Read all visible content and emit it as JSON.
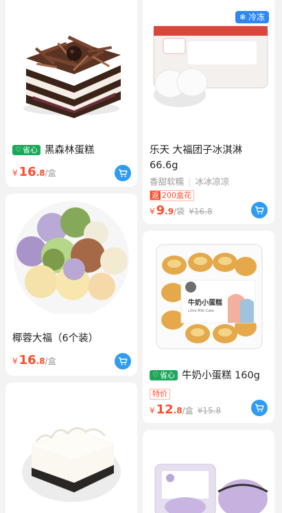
{
  "products": [
    {
      "title": "黑森林蛋糕",
      "badge": "省心",
      "price_currency": "¥",
      "price_int": "16",
      "price_dec": ".8",
      "price_unit": "/盒"
    },
    {
      "title": "乐天 大福团子冰淇淋66.6g",
      "tag1": "香甜软糯",
      "tag2": "冰冰凉凉",
      "promo_prefix": "返",
      "promo_text": "200盒花",
      "price_currency": "¥",
      "price_int": "9",
      "price_dec": ".9",
      "price_unit": "/袋",
      "price_orig": "¥16.8",
      "frozen_label": "冷冻"
    },
    {
      "title": "椰蓉大福（6个装）",
      "price_currency": "¥",
      "price_int": "16",
      "price_dec": ".8",
      "price_unit": "/盒"
    },
    {
      "title": "牛奶小蛋糕 160g",
      "badge": "省心",
      "promo_text": "特价",
      "price_currency": "¥",
      "price_int": "12",
      "price_dec": ".8",
      "price_unit": "/盒",
      "price_orig": "¥15.8",
      "box_label": "牛奶小蛋糕",
      "box_sublabel": "Little Milk Cake"
    }
  ],
  "colors": {
    "accent_red": "#ff4b2b",
    "cart_blue": "#2e9cf2",
    "badge_green": "#1ba85a"
  }
}
